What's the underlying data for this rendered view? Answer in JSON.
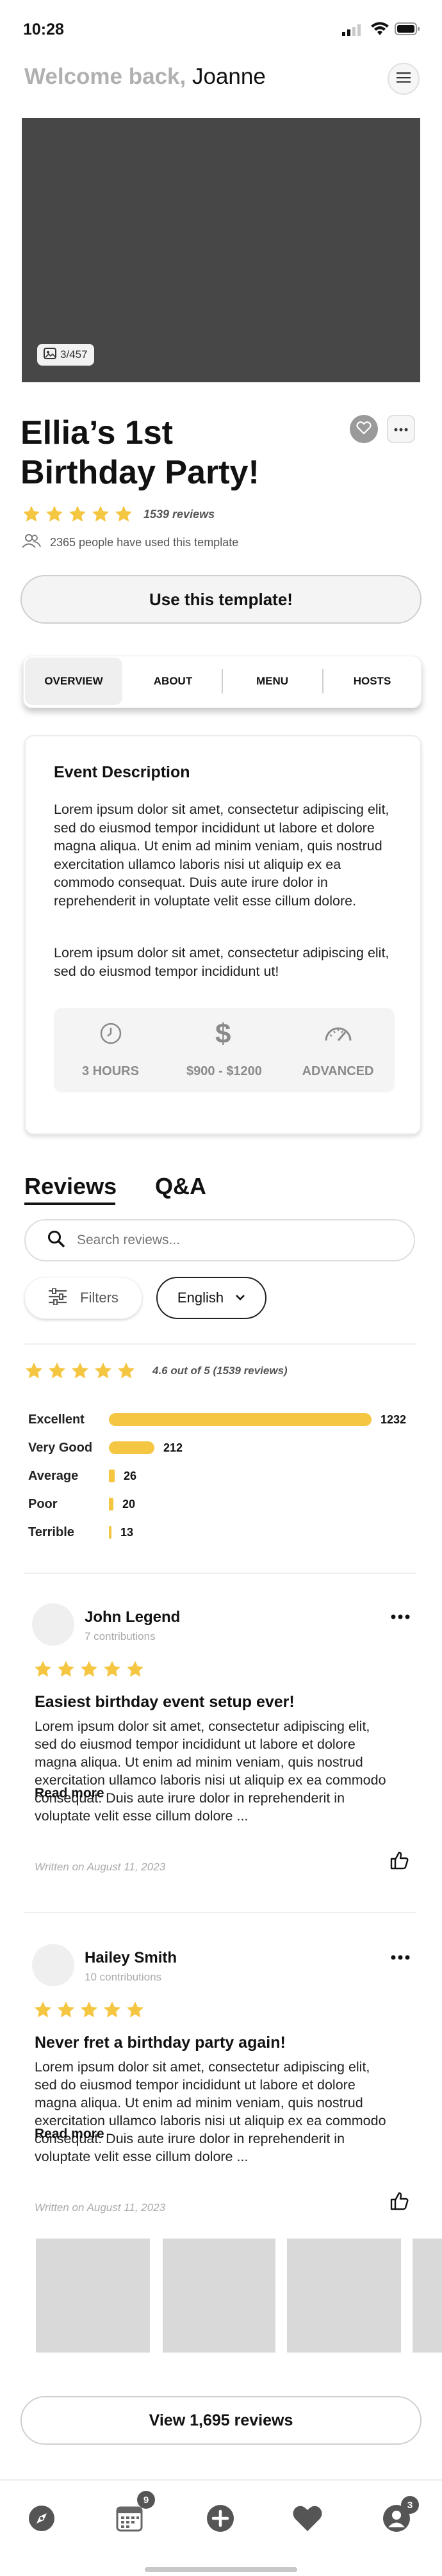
{
  "status_bar": {
    "time": "10:28"
  },
  "header": {
    "greeting": "Welcome back, ",
    "user_name": "Joanne"
  },
  "hero": {
    "photo_counter": "3/457"
  },
  "event": {
    "title_line1": "Ellia’s 1st",
    "title_line2": "Birthday Party!",
    "rating_stars": 5,
    "review_count_label": "1539 reviews",
    "usage_label": "2365 people have used this template",
    "cta_label": "Use this template!"
  },
  "tabs": [
    {
      "label": "OVERVIEW",
      "active": true
    },
    {
      "label": "ABOUT",
      "active": false
    },
    {
      "label": "MENU",
      "active": false
    },
    {
      "label": "HOSTS",
      "active": false
    }
  ],
  "description": {
    "heading": "Event Description",
    "paragraph1": "Lorem ipsum dolor sit amet, consectetur adipiscing elit, sed do eiusmod tempor incididunt ut labore et dolore magna aliqua. Ut enim ad minim veniam, quis nostrud exercitation ullamco laboris nisi ut aliquip ex ea commodo consequat. Duis aute irure dolor in reprehenderit in voluptate velit esse cillum dolore.",
    "paragraph2": "Lorem ipsum dolor sit amet, consectetur adipiscing elit, sed do eiusmod tempor incididunt ut!",
    "stats": [
      {
        "icon": "clock-icon",
        "label": "3 HOURS"
      },
      {
        "icon": "dollar-icon",
        "label": "$900 - $1200"
      },
      {
        "icon": "gauge-icon",
        "label": "ADVANCED"
      }
    ]
  },
  "reviews_section": {
    "tab_reviews": "Reviews",
    "tab_qa": "Q&A",
    "search_placeholder": "Search reviews...",
    "filters_label": "Filters",
    "language_label": "English",
    "average_label": "4.6 out of 5 (1539 reviews)",
    "average_stars": 5,
    "breakdown": [
      {
        "label": "Excellent",
        "count": 1232,
        "display": "1232"
      },
      {
        "label": "Very Good",
        "count": 212,
        "display": "212"
      },
      {
        "label": "Average",
        "count": 26,
        "display": "26"
      },
      {
        "label": "Poor",
        "count": 20,
        "display": "20"
      },
      {
        "label": "Terrible",
        "count": 13,
        "display": "13"
      }
    ],
    "reviews": [
      {
        "author": "John Legend",
        "contributions": "7 contributions",
        "stars": 5,
        "title": "Easiest birthday event setup ever!",
        "body": "Lorem ipsum dolor sit amet, consectetur adipiscing elit, sed do eiusmod tempor incididunt ut labore et dolore magna aliqua. Ut enim ad minim veniam, quis nostrud exercitation ullamco laboris nisi ut aliquip ex ea commodo consequat. Duis aute irure dolor in reprehenderit in voluptate velit esse cillum dolore ...",
        "read_more": "Read more",
        "written_on": "Written on August 11, 2023"
      },
      {
        "author": "Hailey Smith",
        "contributions": "10 contributions",
        "stars": 5,
        "title": "Never fret a birthday party again!",
        "body": "Lorem ipsum dolor sit amet, consectetur adipiscing elit, sed do eiusmod tempor incididunt ut labore et dolore magna aliqua. Ut enim ad minim veniam, quis nostrud exercitation ullamco laboris nisi ut aliquip ex ea commodo consequat. Duis aute irure dolor in reprehenderit in voluptate velit esse cillum dolore ...",
        "read_more": "Read more",
        "written_on": "Written on August 11, 2023"
      }
    ],
    "view_all_label": "View 1,695 reviews"
  },
  "bottom_nav": {
    "items": [
      {
        "icon": "compass-icon",
        "badge": ""
      },
      {
        "icon": "calendar-icon",
        "badge": "9"
      },
      {
        "icon": "add-icon",
        "badge": ""
      },
      {
        "icon": "heart-icon",
        "badge": ""
      },
      {
        "icon": "profile-icon",
        "badge": "3"
      }
    ]
  },
  "colors": {
    "star": "#f5c642",
    "hero": "#474747",
    "placeholder_grey": "#d9d9d9",
    "muted_text": "#9a9a9a"
  }
}
